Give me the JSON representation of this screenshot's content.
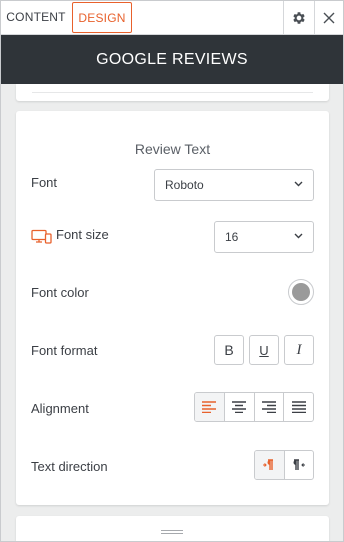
{
  "tabs": {
    "content_label": "CONTENT",
    "design_label": "DESIGN",
    "active": "DESIGN",
    "settings_icon": "gear-icon",
    "close_icon": "close-icon"
  },
  "header": {
    "title": "GOOGLE REVIEWS"
  },
  "section": {
    "title": "Review Text",
    "font": {
      "label": "Font",
      "value": "Roboto"
    },
    "font_size": {
      "label": "Font size",
      "value": "16",
      "icon": "desktop-mobile-icon"
    },
    "font_color": {
      "label": "Font color",
      "value": "#9a9a9a"
    },
    "font_format": {
      "label": "Font format",
      "bold": "B",
      "underline": "U",
      "italic": "I"
    },
    "alignment": {
      "label": "Alignment",
      "selected": "left",
      "options": [
        "left",
        "center",
        "right",
        "justify"
      ]
    },
    "text_direction": {
      "label": "Text direction",
      "selected": "ltr",
      "options": [
        "ltr",
        "rtl"
      ]
    }
  },
  "colors": {
    "accent": "#e8612c",
    "header_bg": "#2f3439",
    "panel_bg": "#eceded"
  }
}
